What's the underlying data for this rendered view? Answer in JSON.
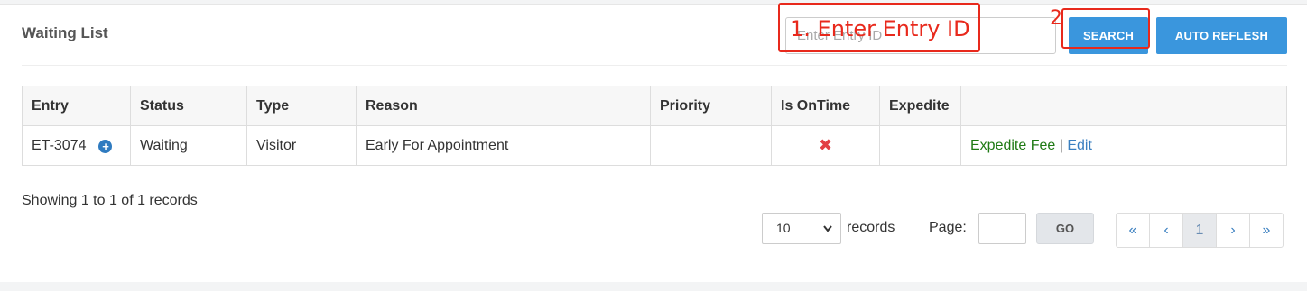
{
  "header": {
    "title": "Waiting List",
    "search_placeholder": "Enter Entry ID",
    "search_button": "SEARCH",
    "refresh_button": "AUTO REFLESH"
  },
  "annotations": {
    "step1": "1. Enter Entry ID",
    "step2": "2",
    "color": "#e8291c"
  },
  "table": {
    "columns": [
      "Entry",
      "Status",
      "Type",
      "Reason",
      "Priority",
      "Is OnTime",
      "Expedite",
      ""
    ],
    "rows": [
      {
        "entry": "ET-3074",
        "entry_icon": "plus-circle-icon",
        "status": "Waiting",
        "type": "Visitor",
        "reason": "Early For Appointment",
        "priority": "",
        "on_time_icon": "x-icon",
        "on_time_glyph": "✖",
        "expedite": "",
        "action_expedite_fee": "Expedite Fee",
        "action_separator": "|",
        "action_edit": "Edit"
      }
    ]
  },
  "footer": {
    "showing": "Showing 1 to 1 of 1 records",
    "page_size": "10",
    "records_label": "records",
    "page_label": "Page:",
    "go_button": "GO",
    "pager": {
      "first": "«",
      "prev": "‹",
      "current": "1",
      "next": "›",
      "last": "»"
    }
  },
  "colors": {
    "primary_button": "#3a96dd",
    "link_green": "#1f7a14",
    "link_blue": "#3a7fc0",
    "error_red": "#e23e44"
  }
}
